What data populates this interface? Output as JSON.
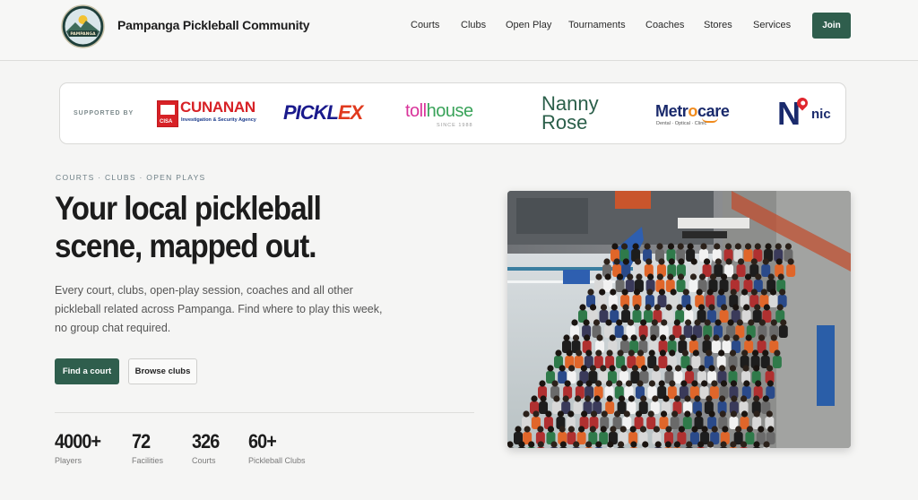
{
  "header": {
    "brand": "Pampanga Pickleball Community",
    "logo_text": "PAMPANGA",
    "nav": [
      {
        "label": "Courts"
      },
      {
        "label": "Clubs"
      },
      {
        "label": "Open Play"
      },
      {
        "label": "Tournaments"
      },
      {
        "label": "Coaches"
      },
      {
        "label": "Stores"
      },
      {
        "label": "Services"
      }
    ],
    "join_label": "Join"
  },
  "sponsors": {
    "label": "SUPPORTED BY",
    "cunanan": {
      "name": "CUNANAN",
      "tag": "Investigation & Security Agency",
      "abbr": "CISA"
    },
    "picklex": {
      "name": "PICKL",
      "x": "EX"
    },
    "tollhouse": {
      "part1": "toll",
      "part2": "house",
      "since": "SINCE 1988"
    },
    "nanny": {
      "line1": "Nanny",
      "line2": "Rose"
    },
    "metrocare": {
      "part1": "Metr",
      "o": "o",
      "part2": "care",
      "tag": "Dental · Optical · Clinic"
    },
    "nic": {
      "n": "N",
      "rest": "nic"
    }
  },
  "hero": {
    "eyebrow": "COURTS · CLUBS · OPEN PLAYS",
    "headline": "Your local pickleball scene, mapped out.",
    "lede": "Every court, clubs, open-play session, coaches and all other pickleball related across Pampanga. Find where to play this week, no group chat required.",
    "primary_cta": "Find a court",
    "secondary_cta": "Browse clubs"
  },
  "stats": [
    {
      "value": "4000+",
      "label": "Players"
    },
    {
      "value": "72",
      "label": "Facilities"
    },
    {
      "value": "326",
      "label": "Courts"
    },
    {
      "value": "60+",
      "label": "Pickleball Clubs"
    }
  ],
  "colors": {
    "accent": "#2f5e4d",
    "background": "#f5f5f4"
  }
}
